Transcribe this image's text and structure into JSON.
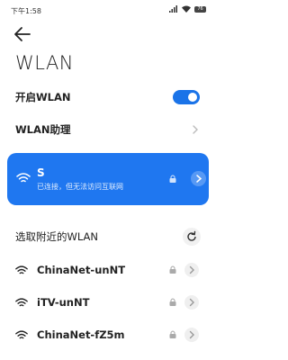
{
  "status_bar": {
    "time": "下午1:58",
    "battery": "76"
  },
  "page": {
    "title": "WLAN"
  },
  "wlan_toggle": {
    "label": "开启WLAN",
    "on": true
  },
  "wlan_assistant": {
    "label": "WLAN助理"
  },
  "connected_network": {
    "ssid": "S",
    "status": "已连接，但无法访问互联网"
  },
  "nearby": {
    "label": "选取附近的WLAN",
    "networks": [
      {
        "name": "ChinaNet-unNT"
      },
      {
        "name": "iTV-unNT"
      },
      {
        "name": "ChinaNet-fZ5m"
      }
    ]
  },
  "colors": {
    "accent": "#1f77f0",
    "toggle": "#1a73e8"
  },
  "icons": [
    "back-arrow-icon",
    "wifi-icon",
    "lock-icon",
    "chevron-right-icon",
    "refresh-icon",
    "signal-icon",
    "battery-icon"
  ]
}
